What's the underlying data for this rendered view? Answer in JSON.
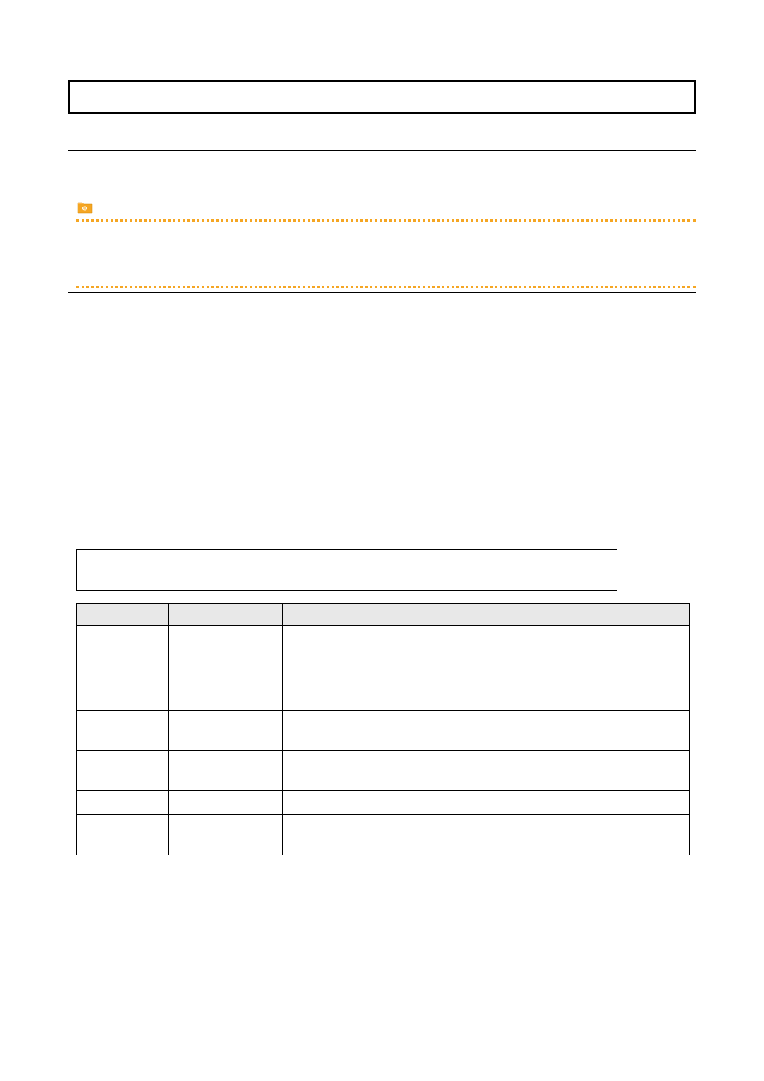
{
  "document": {
    "title_box": "",
    "inner_box": "",
    "content_block_1": "",
    "content_block_2": ""
  },
  "table": {
    "headers": [
      "",
      "",
      ""
    ],
    "rows": [
      {
        "col1": "",
        "col2": "",
        "col3": "",
        "height": "tall"
      },
      {
        "col1": "",
        "col2": "",
        "col3": "",
        "height": "med"
      },
      {
        "col1": "",
        "col2": "",
        "col3": "",
        "height": "med"
      },
      {
        "col1": "",
        "col2": "",
        "col3": "",
        "height": "short"
      },
      {
        "col1": "",
        "col2": "",
        "col3": "",
        "height": "med"
      }
    ]
  },
  "icons": {
    "folder": "folder-icon"
  },
  "colors": {
    "dotted_line": "#f5a623",
    "header_bg": "#e8e8e8"
  }
}
